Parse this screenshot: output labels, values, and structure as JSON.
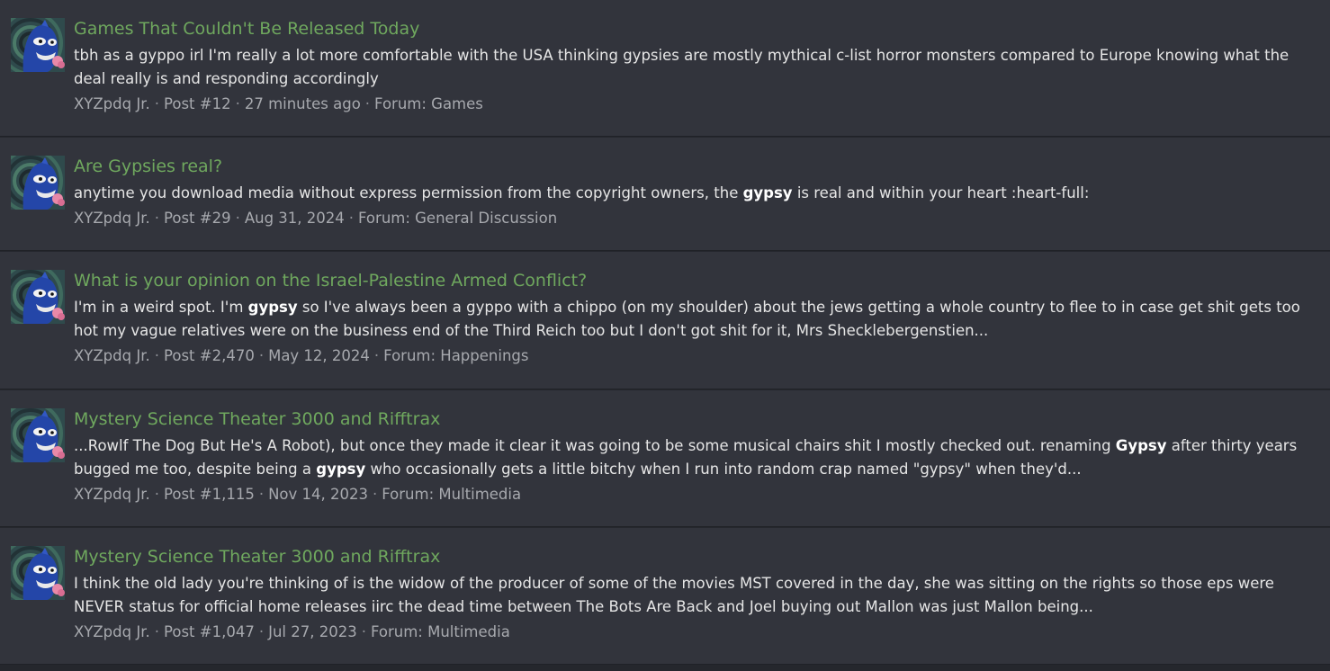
{
  "colors": {
    "page_background": "#25272d",
    "row_background": "#32343c",
    "title_link": "#6fa85e",
    "snippet_text": "#e6e6e6",
    "meta_text": "#a7a9ae"
  },
  "results": [
    {
      "title": "Games That Couldn't Be Released Today",
      "snippet_parts": [
        {
          "text": "tbh as a gyppo irl I'm really a lot more comfortable with the USA thinking gypsies are mostly mythical c-list horror monsters compared to Europe knowing what the deal really is and responding accordingly",
          "bold": false
        }
      ],
      "author": "XYZpdq Jr.",
      "post": "Post #12",
      "date": "27 minutes ago",
      "forum": "Forum: Games",
      "avatar_icon": "luchador-mask-avatar"
    },
    {
      "title": "Are Gypsies real?",
      "snippet_parts": [
        {
          "text": "anytime you download media without express permission from the copyright owners, the ",
          "bold": false
        },
        {
          "text": "gypsy",
          "bold": true
        },
        {
          "text": " is real and within your heart :heart-full:",
          "bold": false
        }
      ],
      "author": "XYZpdq Jr.",
      "post": "Post #29",
      "date": "Aug 31, 2024",
      "forum": "Forum: General Discussion",
      "avatar_icon": "luchador-mask-avatar"
    },
    {
      "title": "What is your opinion on the Israel-Palestine Armed Conflict?",
      "snippet_parts": [
        {
          "text": "I'm in a weird spot. I'm ",
          "bold": false
        },
        {
          "text": "gypsy",
          "bold": true
        },
        {
          "text": " so I've always been a gyppo with a chippo (on my shoulder) about the jews getting a whole country to flee to in case get shit gets too hot my vague relatives were on the business end of the Third Reich too but I don't got shit for it, Mrs Shecklebergenstien...",
          "bold": false
        }
      ],
      "author": "XYZpdq Jr.",
      "post": "Post #2,470",
      "date": "May 12, 2024",
      "forum": "Forum: Happenings",
      "avatar_icon": "luchador-mask-avatar"
    },
    {
      "title": "Mystery Science Theater 3000 and Rifftrax",
      "snippet_parts": [
        {
          "text": "...Rowlf The Dog But He's A Robot), but once they made it clear it was going to be some musical chairs shit I mostly checked out. renaming ",
          "bold": false
        },
        {
          "text": "Gypsy",
          "bold": true
        },
        {
          "text": " after thirty years bugged me too, despite being a ",
          "bold": false
        },
        {
          "text": "gypsy",
          "bold": true
        },
        {
          "text": " who occasionally gets a little bitchy when I run into random crap named \"gypsy\" when they'd...",
          "bold": false
        }
      ],
      "author": "XYZpdq Jr.",
      "post": "Post #1,115",
      "date": "Nov 14, 2023",
      "forum": "Forum: Multimedia",
      "avatar_icon": "luchador-mask-avatar"
    },
    {
      "title": "Mystery Science Theater 3000 and Rifftrax",
      "snippet_parts": [
        {
          "text": "I think the old lady you're thinking of is the widow of the producer of some of the movies MST covered in the day, she was sitting on the rights so those eps were NEVER status for official home releases iirc the dead time between The Bots Are Back and Joel buying out Mallon was just Mallon being...",
          "bold": false
        }
      ],
      "author": "XYZpdq Jr.",
      "post": "Post #1,047",
      "date": "Jul 27, 2023",
      "forum": "Forum: Multimedia",
      "avatar_icon": "luchador-mask-avatar"
    }
  ]
}
